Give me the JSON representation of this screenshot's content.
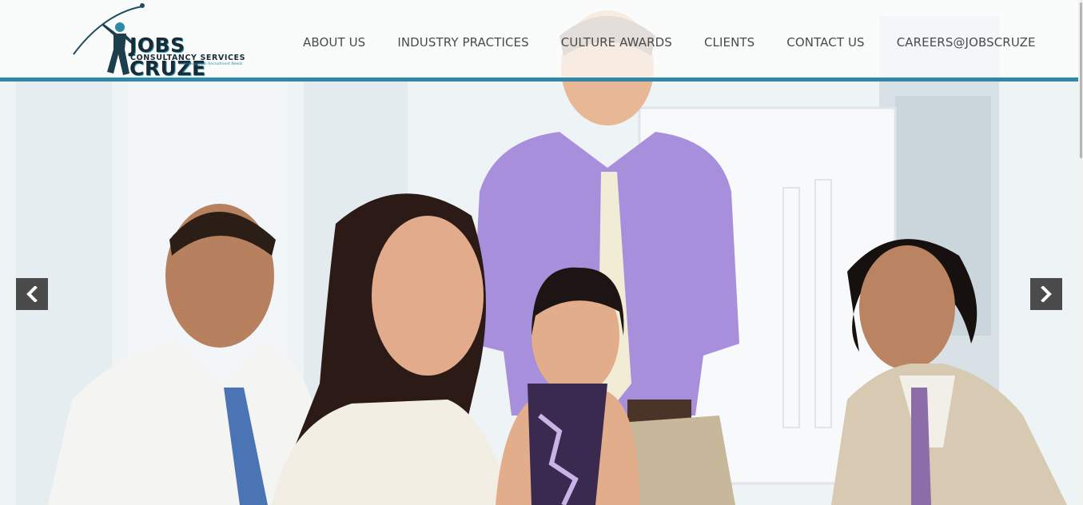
{
  "brand": {
    "name": "JOBS CRUZE",
    "subtitle": "CONSULTANCY SERVICES",
    "tagline": "Serving your Recruitment Needs",
    "accent_color": "#2f88a6"
  },
  "nav": {
    "items": [
      {
        "label": "ABOUT US"
      },
      {
        "label": "INDUSTRY PRACTICES"
      },
      {
        "label": "CULTURE AWARDS"
      },
      {
        "label": "CLIENTS"
      },
      {
        "label": "CONTACT US"
      },
      {
        "label": "CAREERS@JOBSCRUZE"
      }
    ]
  },
  "carousel": {
    "prev_icon": "chevron-left-icon",
    "next_icon": "chevron-right-icon",
    "arrow_color": "#4b4b4b"
  }
}
